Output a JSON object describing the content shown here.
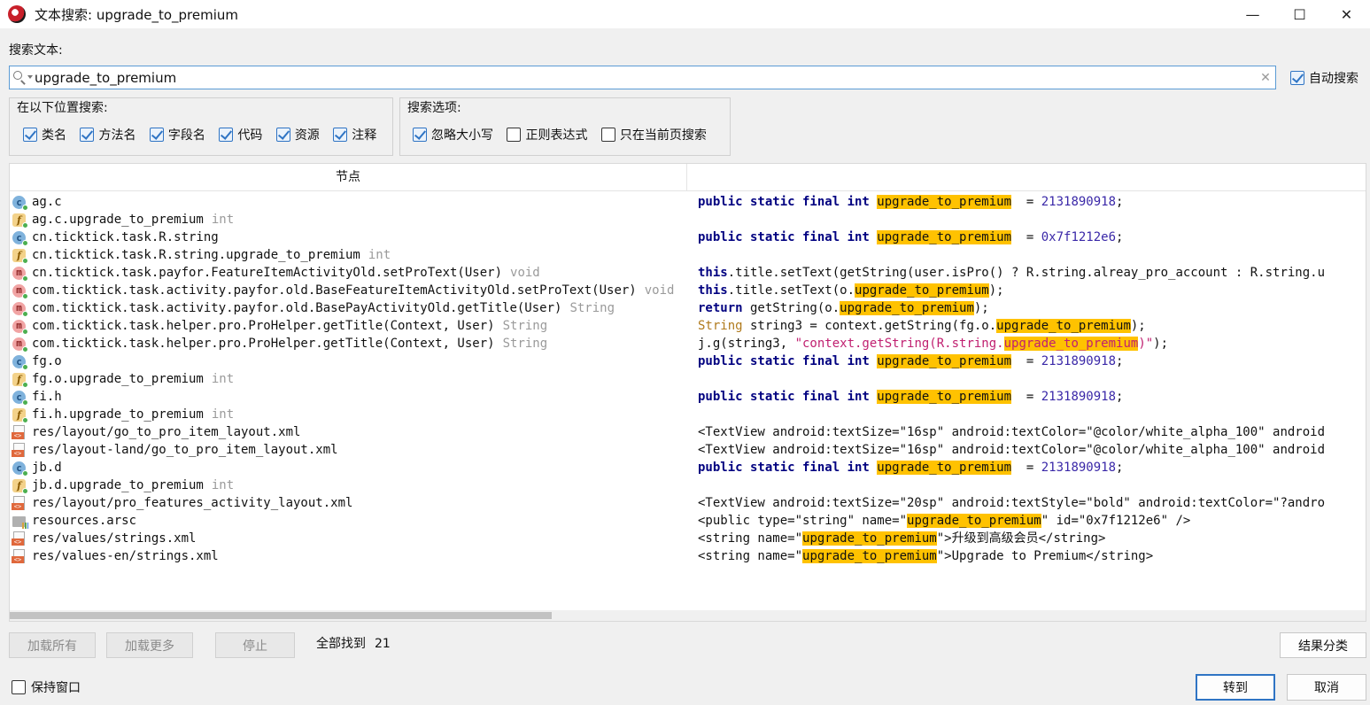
{
  "window": {
    "title": "文本搜索: upgrade_to_premium",
    "minimize": "—",
    "maximize": "☐",
    "close": "✕"
  },
  "search": {
    "label": "搜索文本:",
    "value": "upgrade_to_premium",
    "clear": "✕",
    "auto_search_label": "自动搜索",
    "auto_search_checked": true
  },
  "locations": {
    "title": "在以下位置搜索:",
    "items": [
      {
        "label": "类名",
        "checked": true
      },
      {
        "label": "方法名",
        "checked": true
      },
      {
        "label": "字段名",
        "checked": true
      },
      {
        "label": "代码",
        "checked": true
      },
      {
        "label": "资源",
        "checked": true
      },
      {
        "label": "注释",
        "checked": true
      }
    ]
  },
  "options": {
    "title": "搜索选项:",
    "items": [
      {
        "label": "忽略大小写",
        "checked": true
      },
      {
        "label": "正则表达式",
        "checked": false
      },
      {
        "label": "只在当前页搜索",
        "checked": false
      }
    ]
  },
  "table": {
    "column_node": "节点",
    "column_code": "",
    "rows": [
      {
        "icon": "class",
        "node": "ag.c",
        "type": "",
        "code": [
          [
            "kw",
            "public static final int "
          ],
          [
            "hl",
            "upgrade_to_premium"
          ],
          [
            "",
            "  = "
          ],
          [
            "num",
            "2131890918"
          ],
          [
            "",
            ";"
          ]
        ]
      },
      {
        "icon": "field",
        "node": "ag.c.upgrade_to_premium",
        "type": "int",
        "code": []
      },
      {
        "icon": "class",
        "node": "cn.ticktick.task.R.string",
        "type": "",
        "code": [
          [
            "kw",
            "public static final int "
          ],
          [
            "hl",
            "upgrade_to_premium"
          ],
          [
            "",
            "  = "
          ],
          [
            "num",
            "0x7f1212e6"
          ],
          [
            "",
            ";"
          ]
        ]
      },
      {
        "icon": "field",
        "node": "cn.ticktick.task.R.string.upgrade_to_premium",
        "type": "int",
        "code": []
      },
      {
        "icon": "method",
        "node": "cn.ticktick.task.payfor.FeatureItemActivityOld.setProText(User)",
        "type": "void",
        "code": [
          [
            "kw",
            "this"
          ],
          [
            "",
            ".title.setText(getString(user.isPro() ? R.string.alreay_pro_account : R.string.u"
          ]
        ]
      },
      {
        "icon": "method",
        "node": "com.ticktick.task.activity.payfor.old.BaseFeatureItemActivityOld.setProText(User)",
        "type": "void",
        "code": [
          [
            "kw",
            "this"
          ],
          [
            "",
            ".title.setText(o."
          ],
          [
            "hl",
            "upgrade_to_premium"
          ],
          [
            "",
            ");"
          ]
        ]
      },
      {
        "icon": "method",
        "node": "com.ticktick.task.activity.payfor.old.BasePayActivityOld.getTitle(User)",
        "type": "String",
        "code": [
          [
            "kw",
            "return"
          ],
          [
            "",
            " getString(o."
          ],
          [
            "hl",
            "upgrade_to_premium"
          ],
          [
            "",
            ");"
          ]
        ]
      },
      {
        "icon": "method",
        "node": "com.ticktick.task.helper.pro.ProHelper.getTitle(Context, User)",
        "type": "String",
        "code": [
          [
            "typ",
            "String"
          ],
          [
            "",
            " string3 = context.getString(fg.o."
          ],
          [
            "hl",
            "upgrade_to_premium"
          ],
          [
            "",
            ");"
          ]
        ]
      },
      {
        "icon": "method",
        "node": "com.ticktick.task.helper.pro.ProHelper.getTitle(Context, User)",
        "type": "String",
        "code": [
          [
            "",
            "j.g(string3, "
          ],
          [
            "str",
            "\"context.getString(R.string."
          ],
          [
            "hlstr",
            "upgrade_to_premium"
          ],
          [
            "str",
            ")\""
          ],
          [
            "",
            ");"
          ]
        ]
      },
      {
        "icon": "class",
        "node": "fg.o",
        "type": "",
        "code": [
          [
            "kw",
            "public static final int "
          ],
          [
            "hl",
            "upgrade_to_premium"
          ],
          [
            "",
            "  = "
          ],
          [
            "num",
            "2131890918"
          ],
          [
            "",
            ";"
          ]
        ]
      },
      {
        "icon": "field",
        "node": "fg.o.upgrade_to_premium",
        "type": "int",
        "code": []
      },
      {
        "icon": "class",
        "node": "fi.h",
        "type": "",
        "code": [
          [
            "kw",
            "public static final int "
          ],
          [
            "hl",
            "upgrade_to_premium"
          ],
          [
            "",
            "  = "
          ],
          [
            "num",
            "2131890918"
          ],
          [
            "",
            ";"
          ]
        ]
      },
      {
        "icon": "field",
        "node": "fi.h.upgrade_to_premium",
        "type": "int",
        "code": []
      },
      {
        "icon": "file",
        "node": "res/layout/go_to_pro_item_layout.xml",
        "type": "",
        "code": [
          [
            "",
            "<TextView android:textSize=\"16sp\" android:textColor=\"@color/white_alpha_100\" android"
          ]
        ]
      },
      {
        "icon": "file",
        "node": "res/layout-land/go_to_pro_item_layout.xml",
        "type": "",
        "code": [
          [
            "",
            "<TextView android:textSize=\"16sp\" android:textColor=\"@color/white_alpha_100\" android"
          ]
        ]
      },
      {
        "icon": "class",
        "node": "jb.d",
        "type": "",
        "code": [
          [
            "kw",
            "public static final int "
          ],
          [
            "hl",
            "upgrade_to_premium"
          ],
          [
            "",
            "  = "
          ],
          [
            "num",
            "2131890918"
          ],
          [
            "",
            ";"
          ]
        ]
      },
      {
        "icon": "field",
        "node": "jb.d.upgrade_to_premium",
        "type": "int",
        "code": []
      },
      {
        "icon": "file",
        "node": "res/layout/pro_features_activity_layout.xml",
        "type": "",
        "code": [
          [
            "",
            "<TextView android:textSize=\"20sp\" android:textStyle=\"bold\" android:textColor=\"?andro"
          ]
        ]
      },
      {
        "icon": "folder",
        "node": "resources.arsc",
        "type": "",
        "code": [
          [
            "",
            "<public type=\"string\" name=\""
          ],
          [
            "hl",
            "upgrade_to_premium"
          ],
          [
            "",
            "\" id=\"0x7f1212e6\" />"
          ]
        ]
      },
      {
        "icon": "file",
        "node": "res/values/strings.xml",
        "type": "",
        "code": [
          [
            "",
            "<string name=\""
          ],
          [
            "hl",
            "upgrade_to_premium"
          ],
          [
            "",
            "\">升级到高级会员</string>"
          ]
        ]
      },
      {
        "icon": "file",
        "node": "res/values-en/strings.xml",
        "type": "",
        "code": [
          [
            "",
            "<string name=\""
          ],
          [
            "hl",
            "upgrade_to_premium"
          ],
          [
            "",
            "\">Upgrade to Premium</string>"
          ]
        ]
      }
    ]
  },
  "footer": {
    "load_all": "加载所有",
    "load_more": "加载更多",
    "stop": "停止",
    "found_label": "全部找到",
    "found_count": "21",
    "group_results": "结果分类",
    "keep_window": "保持窗口",
    "keep_window_checked": false,
    "goto": "转到",
    "cancel": "取消"
  }
}
